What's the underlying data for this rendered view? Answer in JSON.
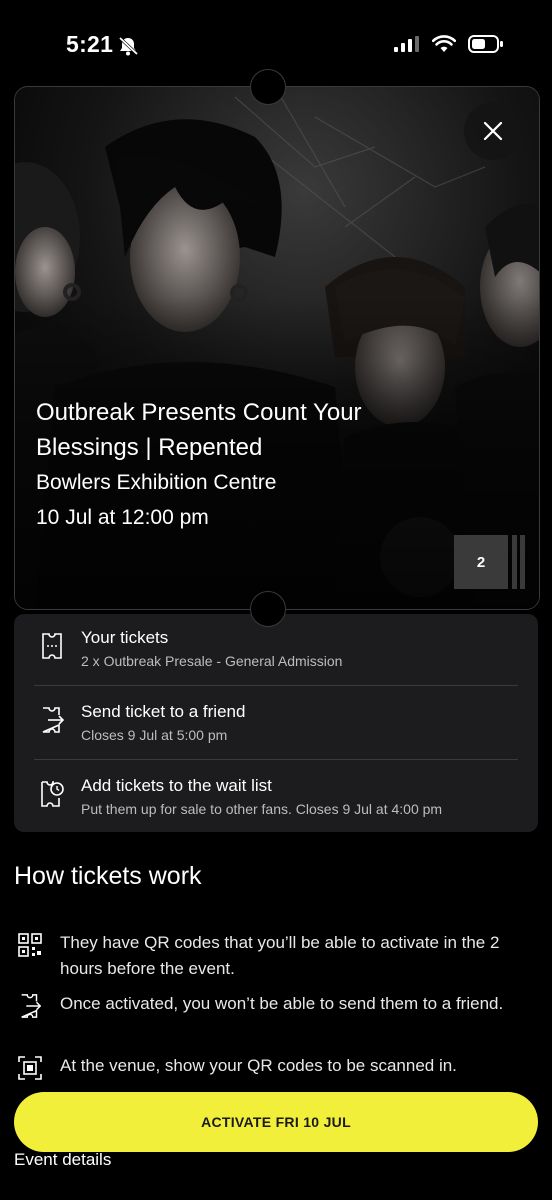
{
  "status_bar": {
    "time": "5:21",
    "icons": [
      "bell-slash-icon",
      "cellular-signal-icon",
      "wifi-icon",
      "battery-icon"
    ]
  },
  "event": {
    "title": "Outbreak Presents Count Your Blessings | Repented",
    "venue": "Bowlers Exhibition Centre",
    "datetime": "10 Jul at 12:00 pm",
    "ticket_count": "2"
  },
  "actions": [
    {
      "title": "Your tickets",
      "subtitle": "2 x Outbreak Presale - General Admission",
      "icon": "ticket-icon"
    },
    {
      "title": "Send ticket to a friend",
      "subtitle": "Closes 9 Jul at 5:00 pm",
      "icon": "send-ticket-icon"
    },
    {
      "title": "Add tickets to the wait list",
      "subtitle": "Put them up for sale to other fans. Closes 9 Jul at 4:00 pm",
      "icon": "ticket-clock-icon"
    }
  ],
  "how_it_works": {
    "heading": "How tickets work",
    "items": [
      {
        "text": "They have QR codes that you’ll be able to activate in the 2 hours before the event.",
        "icon": "qr-code-icon"
      },
      {
        "text": "Once activated, you won’t be able to send them to a friend.",
        "icon": "send-ticket-icon"
      },
      {
        "text": "At the venue, show your QR codes to be scanned in.",
        "icon": "scan-qr-icon"
      }
    ]
  },
  "activate_button": {
    "label": "ACTIVATE FRI 10 JUL"
  },
  "event_details_link": "Event details",
  "colors": {
    "background": "#000000",
    "panel": "#1c1c1e",
    "accent_yellow": "#f2ef3a",
    "subtext": "#bdbdbd"
  }
}
